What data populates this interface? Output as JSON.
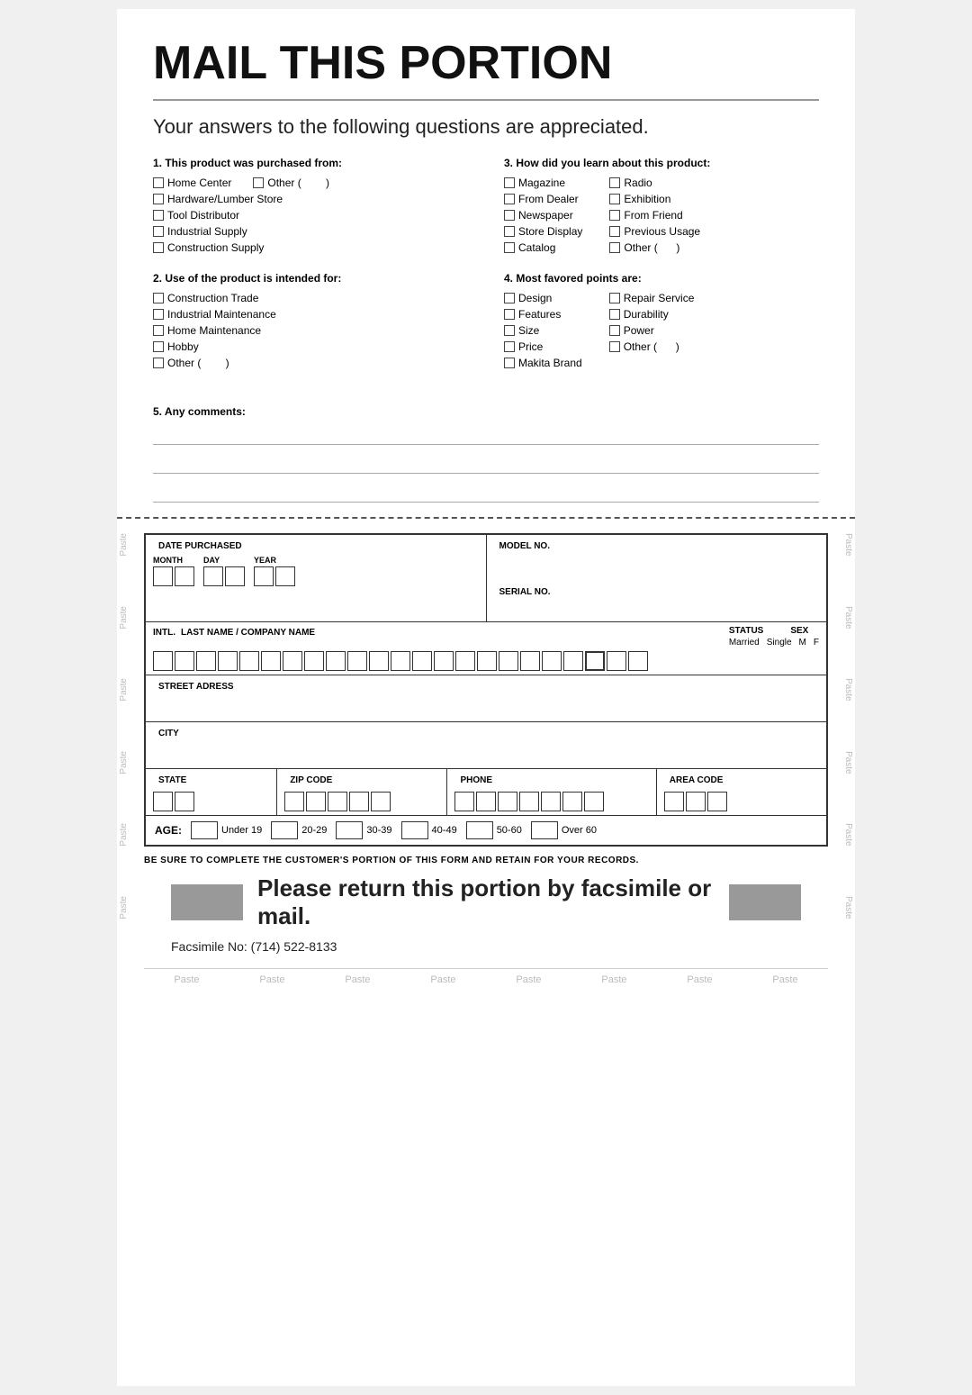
{
  "title": "MAIL THIS PORTION",
  "subtitle": "Your answers to the following questions are appreciated.",
  "section1": {
    "title": "1. This product was purchased from:",
    "options": [
      "Home Center",
      "Other (",
      "Hardware/Lumber Store",
      "Tool Distributor",
      "Industrial Supply",
      "Construction Supply"
    ]
  },
  "section2": {
    "title": "2. Use of the product is intended for:",
    "options": [
      "Construction Trade",
      "Industrial Maintenance",
      "Home Maintenance",
      "Hobby",
      "Other ("
    ]
  },
  "section3": {
    "title": "3. How did you learn about this product:",
    "col1": [
      "Magazine",
      "From Dealer",
      "Newspaper",
      "Store Display",
      "Catalog"
    ],
    "col2": [
      "Radio",
      "Exhibition",
      "From Friend",
      "Previous Usage",
      "Other ("
    ]
  },
  "section4": {
    "title": "4. Most favored points are:",
    "col1": [
      "Design",
      "Features",
      "Size",
      "Price",
      "Makita Brand"
    ],
    "col2": [
      "Repair Service",
      "Durability",
      "Power",
      "Other ("
    ]
  },
  "section5": {
    "title": "5. Any comments:"
  },
  "form": {
    "date_purchased": "DATE PURCHASED",
    "month": "MONTH",
    "day": "DAY",
    "year": "YEAR",
    "model_no": "MODEL NO.",
    "serial_no": "SERIAL NO.",
    "intl": "INTL.",
    "last_name_company": "LAST NAME / COMPANY NAME",
    "status": "STATUS",
    "sex": "SEX",
    "married": "Married",
    "single": "Single",
    "m": "M",
    "f": "F",
    "street": "STREET ADRESS",
    "city": "CITY",
    "state": "STATE",
    "zip_code": "ZIP CODE",
    "phone": "PHONE",
    "area_code": "AREA CODE",
    "age": "AGE:",
    "age_options": [
      "Under 19",
      "20-29",
      "30-39",
      "40-49",
      "50-60",
      "Over 60"
    ]
  },
  "retain_note": "BE SURE TO COMPLETE THE CUSTOMER'S PORTION OF THIS FORM AND RETAIN FOR YOUR RECORDS.",
  "return_text": "Please return this portion by facsimile or mail.",
  "fax": "Facsimile No: (714) 522-8133",
  "paste_labels": [
    "Paste",
    "Paste",
    "Paste",
    "Paste",
    "Paste",
    "Paste",
    "Paste",
    "Paste"
  ],
  "side_paste": [
    "Paste",
    "Paste",
    "Paste",
    "Paste",
    "Paste",
    "Paste"
  ]
}
